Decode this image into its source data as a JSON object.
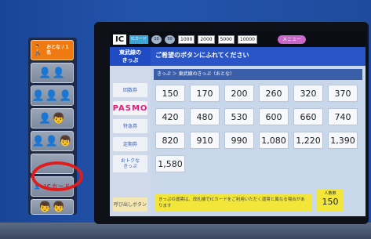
{
  "left_panel": {
    "active_button": {
      "icon": "adult-person-icon",
      "text": "おとな / 1名"
    },
    "buttons": [
      {
        "label": "👤👤",
        "icon": "two-persons-icon"
      },
      {
        "label": "👤👤👤",
        "icon": "three-persons-icon"
      },
      {
        "label": "👤👦",
        "icon": "adult-child-icon"
      },
      {
        "label": "👤👤👦",
        "icon": "two-adults-child-icon"
      },
      {
        "label": "",
        "icon": "blank-button"
      },
      {
        "label": "👤 ICカード",
        "icon": "person-ic-card-icon"
      },
      {
        "label": "👦👦",
        "icon": "two-children-icon"
      }
    ]
  },
  "screen": {
    "topbar": {
      "ic": "IC",
      "ic_tag": "ICカード",
      "coins": [
        "10",
        "50"
      ],
      "bills": [
        "1000",
        "2000",
        "5000",
        "10000"
      ],
      "menu": "メニュー"
    },
    "header_left": "東武線の\nきっぷ",
    "header_right": "ご希望のボタンにふれてください",
    "breadcrumb": "きっぷ ＞ 東武線のきっぷ（おとな）",
    "side_buttons": [
      {
        "label": "回数券",
        "style": "normal"
      },
      {
        "label": "PASMO",
        "style": "pasmo"
      },
      {
        "label": "特急券",
        "style": "normal"
      },
      {
        "label": "定期券",
        "style": "normal"
      },
      {
        "label": "おトクな\nきっぷ",
        "style": "normal"
      },
      {
        "label": "呼び出しボタン",
        "style": "yellow"
      }
    ],
    "fares": [
      [
        "150",
        "170",
        "200",
        "260",
        "320",
        "370"
      ],
      [
        "420",
        "480",
        "530",
        "600",
        "660",
        "740"
      ],
      [
        "820",
        "910",
        "990",
        "1,080",
        "1,220",
        "1,390"
      ],
      [
        "1,580"
      ]
    ],
    "notice": "きっぷの運賃は、改札機でICカードをご利用いただく運賃と異なる場合があります",
    "count_box": {
      "label": "人数券",
      "value": "150"
    }
  },
  "colors": {
    "accent_orange": "#f07a12",
    "circle_red": "#e21b1b",
    "pasmo_pink": "#e3197a",
    "notice_yellow": "#f2e63b",
    "header_blue": "#2a55c8"
  }
}
